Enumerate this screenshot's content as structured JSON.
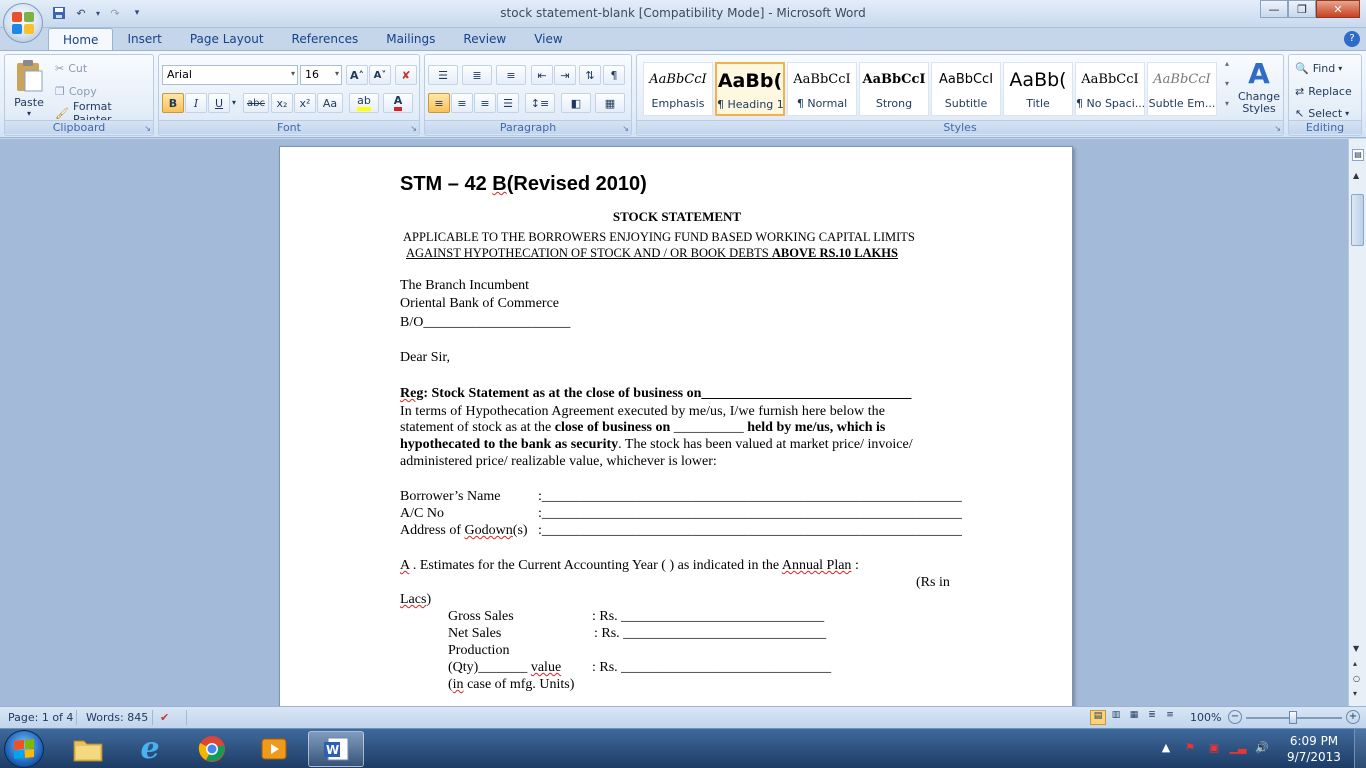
{
  "window": {
    "title": "stock statement-blank [Compatibility Mode] - Microsoft Word",
    "minimize": "—",
    "maximize": "❐",
    "close": "✕"
  },
  "tabs": [
    "Home",
    "Insert",
    "Page Layout",
    "References",
    "Mailings",
    "Review",
    "View"
  ],
  "ribbon": {
    "clipboard": {
      "label": "Clipboard",
      "paste": "Paste",
      "cut": "Cut",
      "copy": "Copy",
      "format_painter": "Format Painter"
    },
    "font": {
      "label": "Font",
      "font_name": "Arial",
      "font_size": "16",
      "bold": "B",
      "italic": "I",
      "underline": "U",
      "strike": "abc",
      "subscript": "x₂",
      "superscript": "x²",
      "change_case": "Aa",
      "grow": "A˄",
      "shrink": "A˅"
    },
    "paragraph": {
      "label": "Paragraph"
    },
    "styles": {
      "label": "Styles",
      "items": [
        {
          "sample": "AaBbCcI",
          "name": "Emphasis"
        },
        {
          "sample": "AaBb(",
          "name": "¶ Heading 1"
        },
        {
          "sample": "AaBbCcI",
          "name": "¶ Normal"
        },
        {
          "sample": "AaBbCcI",
          "name": "Strong"
        },
        {
          "sample": "AaBbCcI",
          "name": "Subtitle"
        },
        {
          "sample": "AaBb(",
          "name": "Title"
        },
        {
          "sample": "AaBbCcI",
          "name": "¶ No Spaci..."
        },
        {
          "sample": "AaBbCcI",
          "name": "Subtle Em..."
        }
      ],
      "change_styles": "Change Styles"
    },
    "editing": {
      "label": "Editing",
      "find": "Find",
      "replace": "Replace",
      "select": "Select"
    }
  },
  "document": {
    "heading_a": "STM – 42 ",
    "heading_b": "B",
    "heading_c": "(Revised 2010)",
    "title": "STOCK STATEMENT",
    "applicable_1": "APPLICABLE  TO  THE  BORROWERS  ENJOYING  FUND  BASED  WORKING  CAPITAL  LIMITS",
    "applicable_2a": "AGAINST  HYPOTHECATION  OF  STOCK  AND  /  OR  BOOK  DEBTS ",
    "applicable_2b": "ABOVE  RS.10  LAKHS",
    "addr_1": "The Branch Incumbent",
    "addr_2": "Oriental Bank of Commerce",
    "addr_3": "B/O_____________________",
    "salutation": "Dear Sir,",
    "reg_a": "Reg",
    "reg_b": ": Stock Statement as at the close of business on______________________________",
    "para_1": " In terms of Hypothecation Agreement executed by me/us, I/we furnish here below the",
    "para_2a": "statement  of  stock  as  at  the ",
    "para_2b": "close of   business on",
    "para_2c": " __________ ",
    "para_2d": "held by me/us, which is",
    "para_3a": "hypothecated to the bank as security",
    "para_3b": ". The stock has been valued at market price/ invoice/",
    "para_4": "administered price/ realizable value, whichever is lower:",
    "borrower_label": "Borrower’s Name",
    "acno_label": "A/C No",
    "addr_label_a": "Address of ",
    "addr_label_b": "Godown",
    "addr_label_c": "(s)",
    "field_line": ":____________________________________________________________",
    "section_a_a": "A",
    "section_a_b": " . Estimates for the Current Accounting Year (              ) as indicated in the ",
    "section_a_c": "Annual  Plan",
    "section_a_d": " :",
    "rs_in": "(Rs in",
    "lacs": "Lacs",
    "lacs_paren": ")",
    "gross_sales": "Gross Sales",
    "net_sales": "Net Sales",
    "production": "Production",
    "qty_a": "(Qty",
    "qty_b": ")_______ ",
    "qty_c": "value",
    "mfg_a": "(",
    "mfg_b": "in",
    "mfg_c": " case of mfg. Units)",
    "rs_gross": ": Rs.     _____________________________",
    "rs_net": ": Rs.     _____________________________",
    "rs_prod": ": Rs.    ______________________________"
  },
  "status": {
    "page": "Page: 1 of 4",
    "words": "Words: 845",
    "zoom": "100%"
  },
  "taskbar": {
    "time": "6:09 PM",
    "date": "9/7/2013"
  },
  "colors": {
    "accent": "#15428b",
    "ribbon_bg": "#dfe9f5",
    "taskbar": "#1d3c66"
  }
}
